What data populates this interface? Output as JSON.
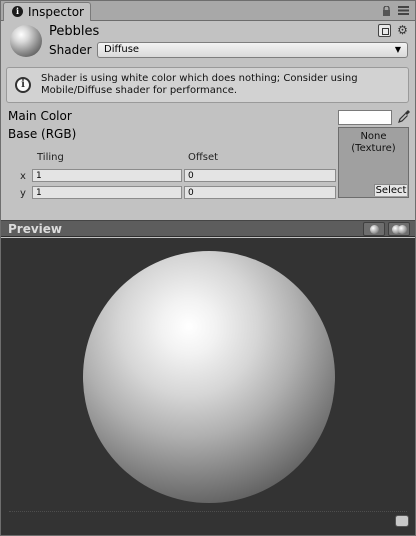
{
  "window": {
    "tab_label": "Inspector"
  },
  "material": {
    "name": "Pebbles",
    "shader_label": "Shader",
    "shader_value": "Diffuse"
  },
  "help": {
    "message": "Shader is using white color which does nothing; Consider using Mobile/Diffuse shader for performance."
  },
  "properties": {
    "main_color_label": "Main Color",
    "main_color_value": "#ffffff",
    "base_label": "Base (RGB)",
    "texture_none": "None\n(Texture)",
    "texture_select": "Select",
    "tiling_label": "Tiling",
    "offset_label": "Offset",
    "x_label": "x",
    "y_label": "y",
    "tiling_x": "1",
    "tiling_y": "1",
    "offset_x": "0",
    "offset_y": "0"
  },
  "preview": {
    "title": "Preview"
  },
  "icons": {
    "tab": "info-icon",
    "lock": "lock-icon",
    "menu": "context-menu-icon",
    "edit": "edit-shader-icon",
    "gear": "gear-icon",
    "help": "info-icon",
    "picker": "eyedropper-icon"
  }
}
